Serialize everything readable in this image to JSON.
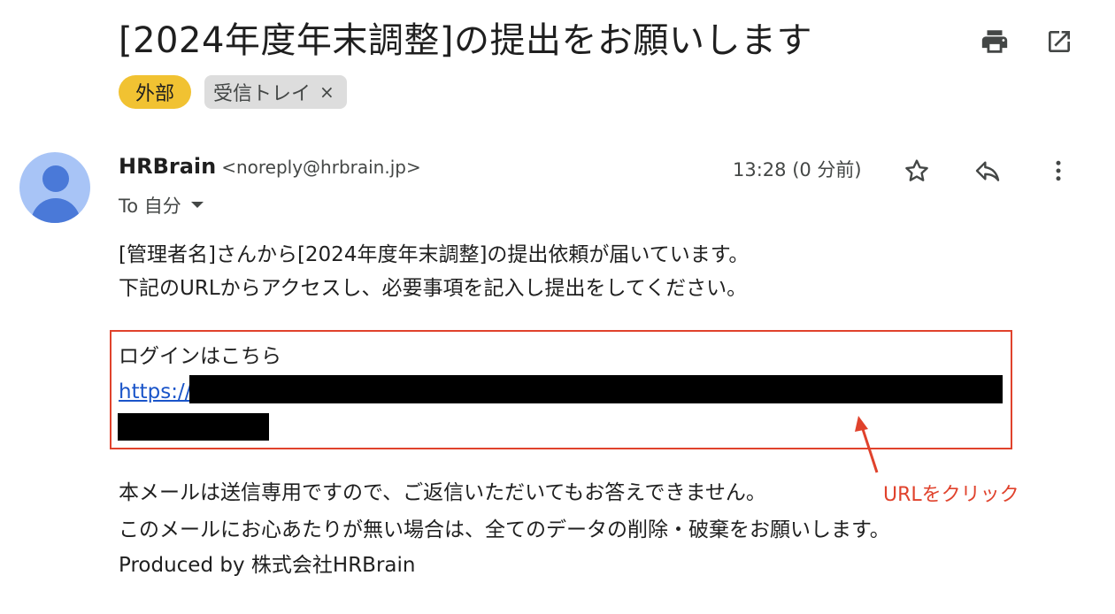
{
  "email": {
    "subject": "[2024年度年末調整]の提出をお願いします",
    "labels": {
      "external": "外部",
      "inbox": "受信トレイ",
      "remove_symbol": "×"
    },
    "sender": {
      "name": "HRBrain",
      "email": "<noreply@hrbrain.jp>"
    },
    "recipient": "To 自分",
    "time": "13:28 (0 分前)",
    "body": {
      "line1": "[管理者名]さんから[2024年度年末調整]の提出依頼が届いています。",
      "line2": "下記のURLからアクセスし、必要事項を記入し提出をしてください。",
      "login_heading": "ログインはこちら",
      "login_link_prefix": "https://",
      "footer1": "本メールは送信専用ですので、ご返信いただいてもお答えできません。",
      "footer2": "このメールにお心あたりが無い場合は、全てのデータの削除・破棄をお願いします。",
      "footer3": "Produced by 株式会社HRBrain"
    }
  },
  "annotation": {
    "text": "URLをクリック",
    "color": "#e0422c"
  },
  "icons": [
    "print-icon",
    "open-in-new-icon",
    "star-icon",
    "reply-icon",
    "more-vert-icon",
    "chevron-down-icon",
    "avatar-icon"
  ],
  "colors": {
    "external_chip": "#f1c232",
    "link": "#1a55c9",
    "highlight_border": "#e0422c"
  }
}
